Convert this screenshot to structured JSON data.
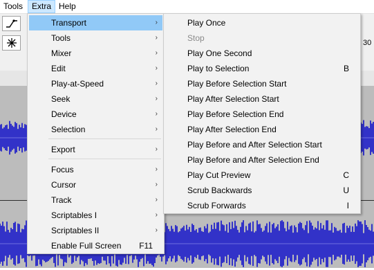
{
  "menubar": {
    "tools": "Tools",
    "extra": "Extra",
    "help": "Help"
  },
  "toolbar": {
    "icon_top": "draw-tool-icon",
    "icon_bottom": "multi-tool-icon",
    "right_readout": "30"
  },
  "extra_menu": {
    "items": [
      {
        "label": "Transport",
        "arrow": "›"
      },
      {
        "label": "Tools",
        "arrow": "›"
      },
      {
        "label": "Mixer",
        "arrow": "›"
      },
      {
        "label": "Edit",
        "arrow": "›"
      },
      {
        "label": "Play-at-Speed",
        "arrow": "›"
      },
      {
        "label": "Seek",
        "arrow": "›"
      },
      {
        "label": "Device",
        "arrow": "›"
      },
      {
        "label": "Selection",
        "arrow": "›"
      },
      {
        "label": "Export",
        "arrow": "›"
      },
      {
        "label": "Focus",
        "arrow": "›"
      },
      {
        "label": "Cursor",
        "arrow": "›"
      },
      {
        "label": "Track",
        "arrow": "›"
      },
      {
        "label": "Scriptables I",
        "arrow": "›"
      },
      {
        "label": "Scriptables II",
        "arrow": "›"
      },
      {
        "label": "Enable Full Screen",
        "shortcut": "F11"
      }
    ]
  },
  "transport_menu": {
    "items": [
      {
        "label": "Play Once"
      },
      {
        "label": "Stop"
      },
      {
        "label": "Play One Second"
      },
      {
        "label": "Play to Selection",
        "shortcut": "B"
      },
      {
        "label": "Play Before Selection Start"
      },
      {
        "label": "Play After Selection Start"
      },
      {
        "label": "Play Before Selection End"
      },
      {
        "label": "Play After Selection End"
      },
      {
        "label": "Play Before and After Selection Start"
      },
      {
        "label": "Play Before and After Selection End"
      },
      {
        "label": "Play Cut Preview",
        "shortcut": "C"
      },
      {
        "label": "Scrub Backwards",
        "shortcut": "U"
      },
      {
        "label": "Scrub Forwards",
        "shortcut": "I"
      }
    ]
  },
  "colors": {
    "highlight": "#91c9f7",
    "menubar_active": "#cce8ff",
    "waveform": "#3232c8",
    "track_bg": "#bcbcbc"
  }
}
